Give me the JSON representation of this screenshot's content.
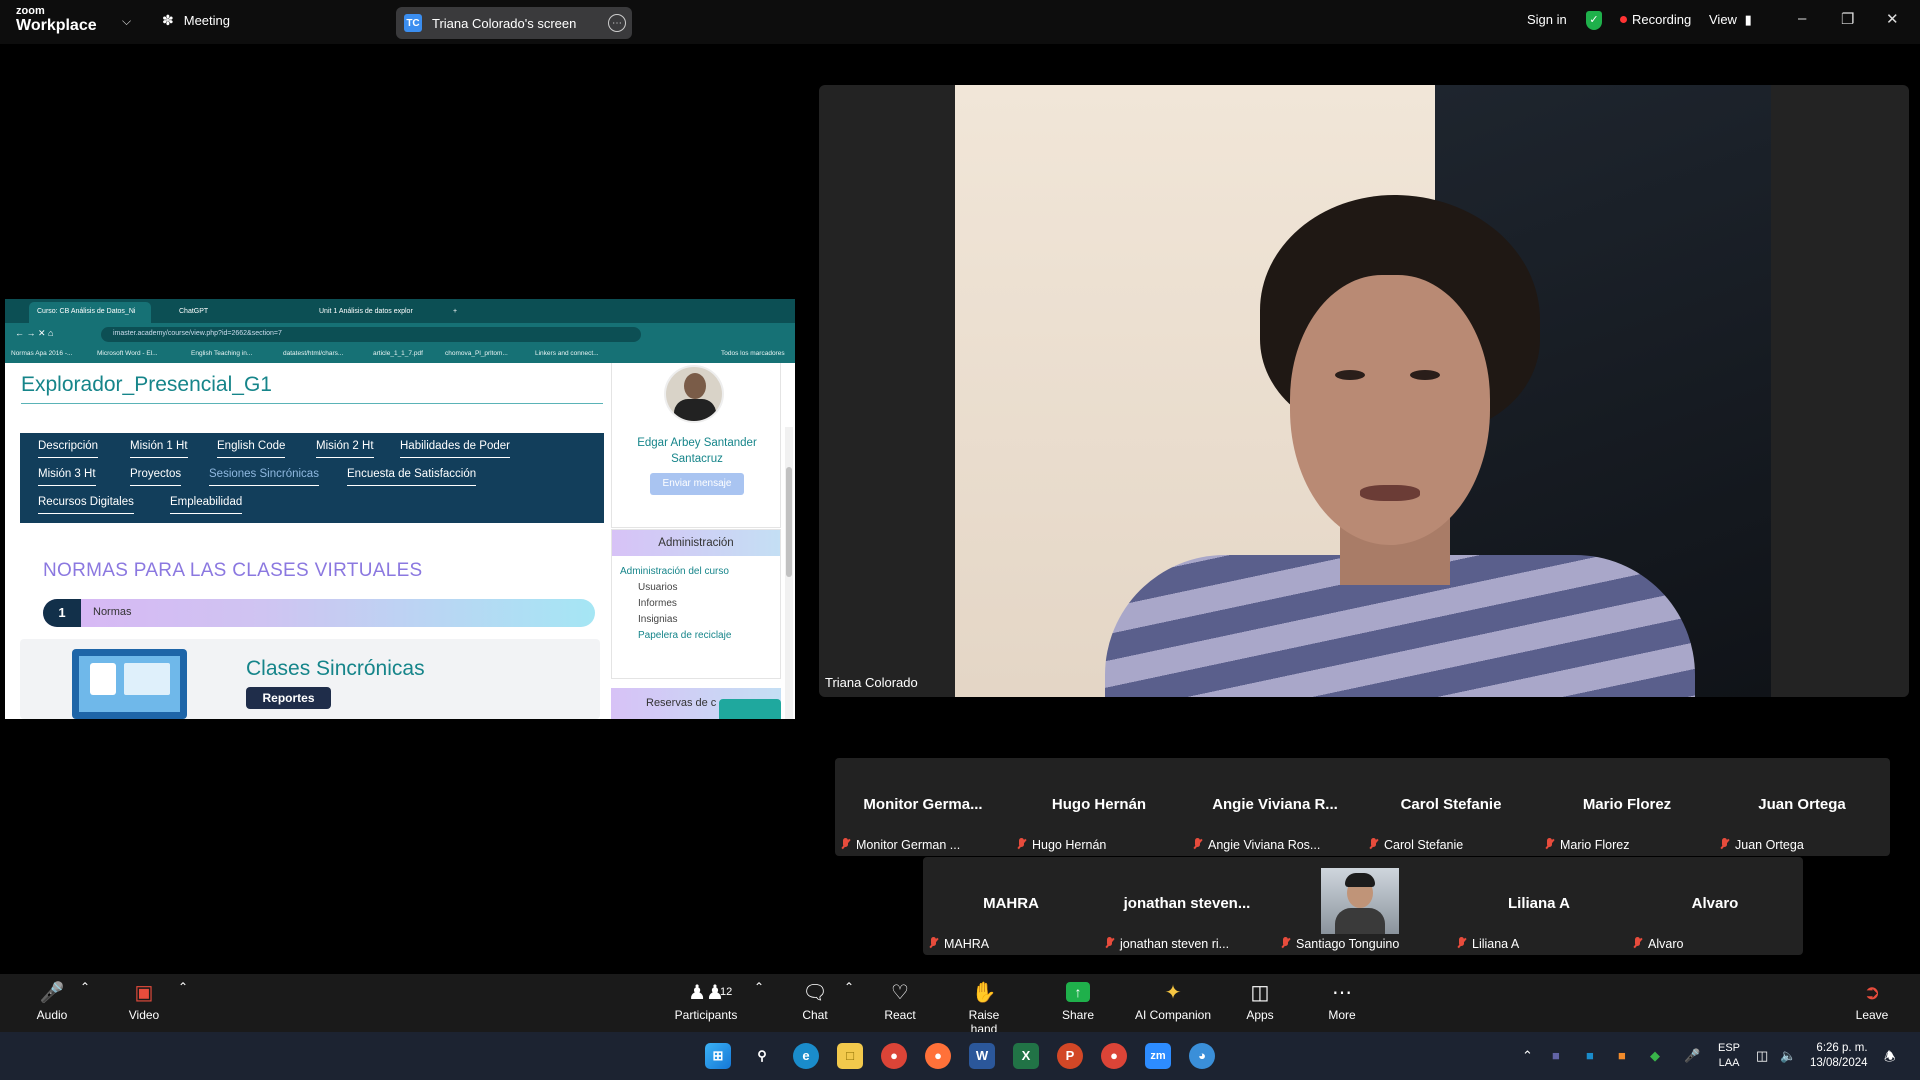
{
  "app": {
    "logo_small": "zoom",
    "logo_big": "Workplace",
    "meeting_label": "Meeting",
    "share_pill": {
      "initials": "TC",
      "label": "Triana Colorado's screen"
    },
    "sign_in": "Sign in",
    "recording": "Recording",
    "view": "View",
    "colors": {
      "topbar": "#0d0d0d",
      "toolbar": "#1a1a1a",
      "accent_green": "#1fb04b",
      "muted_red": "#e74c3c"
    }
  },
  "shared_screen": {
    "browser": {
      "tabs": [
        "Curso: CB Análisis de Datos_Ni",
        "ChatGPT",
        "Unit 1 Análisis de datos explor"
      ],
      "url": "imaster.academy/course/view.php?id=2662&section=7",
      "bookmarks": [
        "Normas Apa 2016 -...",
        "Microsoft Word - El...",
        "English Teaching in...",
        "datatest/html/chars...",
        "article_1_1_7.pdf",
        "chomova_Pl_prltom...",
        "Linkers and connect...",
        "Todos los marcadores"
      ]
    },
    "page": {
      "course_title": "Explorador_Presencial_G1",
      "tabs_row1": [
        "Descripción",
        "Misión 1 Ht",
        "English Code",
        "Misión 2 Ht",
        "Habilidades de Poder"
      ],
      "tabs_row2": [
        "Misión 3 Ht",
        "Proyectos",
        "Sesiones Sincrónicas",
        "Encuesta de Satisfacción"
      ],
      "tabs_row3": [
        "Recursos Digitales",
        "Empleabilidad"
      ],
      "section_heading": "NORMAS PARA LAS CLASES VIRTUALES",
      "normas_number": "1",
      "normas_label": "Normas",
      "card_title": "Clases Sincrónicas",
      "card_button": "Reportes",
      "profile_name_line1": "Edgar Arbey Santander",
      "profile_name_line2": "Santacruz",
      "send_message": "Enviar mensaje",
      "admin_header": "Administración",
      "admin_items": [
        "Administración del curso",
        "Usuarios",
        "Informes",
        "Insignias",
        "Papelera de reciclaje"
      ],
      "reservas": "Reservas de c"
    }
  },
  "speaker": {
    "name": "Triana Colorado"
  },
  "participants_row1": [
    {
      "big": "Monitor  Germa...",
      "small": "Monitor German ..."
    },
    {
      "big": "Hugo Hernán",
      "small": "Hugo Hernán"
    },
    {
      "big": "Angie Viviana R...",
      "small": "Angie Viviana Ros..."
    },
    {
      "big": "Carol Stefanie",
      "small": "Carol Stefanie"
    },
    {
      "big": "Mario Florez",
      "small": "Mario Florez"
    },
    {
      "big": "Juan Ortega",
      "small": "Juan Ortega"
    }
  ],
  "participants_row2": [
    {
      "big": "MAHRA",
      "small": "MAHRA"
    },
    {
      "big": "jonathan  steven...",
      "small": "jonathan steven ri..."
    },
    {
      "big": "",
      "small": "Santiago Tonguino"
    },
    {
      "big": "Liliana A",
      "small": "Liliana A"
    },
    {
      "big": "Alvaro",
      "small": "Alvaro"
    }
  ],
  "toolbar": {
    "audio": "Audio",
    "video": "Video",
    "participants": "Participants",
    "participants_count": "12",
    "chat": "Chat",
    "react": "React",
    "raise_hand": "Raise hand",
    "share": "Share",
    "ai_companion": "AI Companion",
    "apps": "Apps",
    "more": "More",
    "leave": "Leave"
  },
  "taskbar": {
    "lang_top": "ESP",
    "lang_bottom": "LAA",
    "time": "6:26 p. m.",
    "date": "13/08/2024"
  }
}
